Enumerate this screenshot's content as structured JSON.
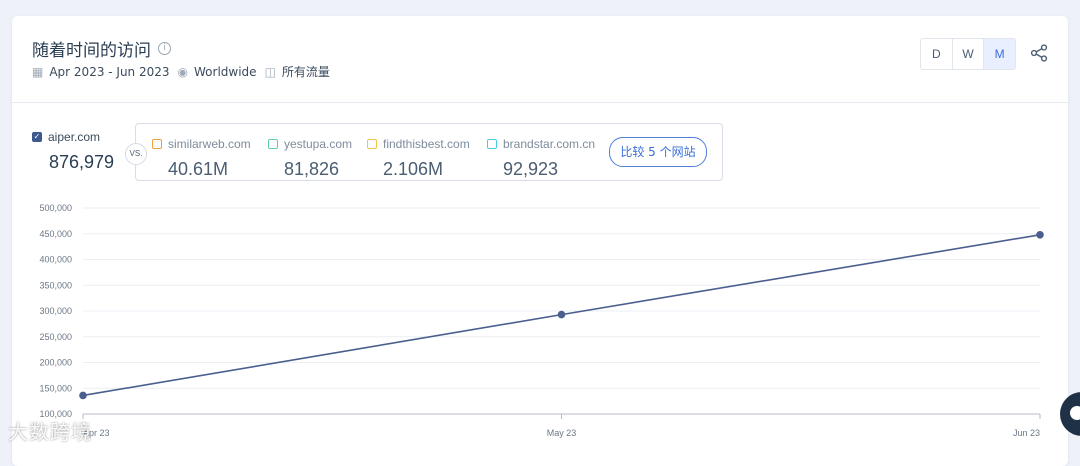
{
  "header": {
    "title": "随着时间的访问",
    "date_range": "Apr 2023 - Jun 2023",
    "region": "Worldwide",
    "traffic_type": "所有流量",
    "granularity": [
      "D",
      "W",
      "M"
    ],
    "selected_granularity": "M"
  },
  "main_site": {
    "name": "aiper.com",
    "value": "876,979",
    "checked": true
  },
  "vs_label": "VS.",
  "competitors": [
    {
      "name": "similarweb.com",
      "value": "40.61M",
      "color": "#f39a45"
    },
    {
      "name": "yestupa.com",
      "value": "81,826",
      "color": "#5ed1ac"
    },
    {
      "name": "findthisbest.com",
      "value": "2.106M",
      "color": "#f6c14e"
    },
    {
      "name": "brandstar.com.cn",
      "value": "92,923",
      "color": "#4dc7e6"
    }
  ],
  "compare_button": "比较 5 个网站",
  "chart_data": {
    "type": "line",
    "x": [
      "Apr 23",
      "May 23",
      "Jun 23"
    ],
    "series": [
      {
        "name": "aiper.com",
        "color": "#4a5f8e",
        "values": [
          136000,
          293000,
          448000
        ]
      }
    ],
    "ylim": [
      100000,
      500000
    ],
    "yticks": [
      "100,000",
      "150,000",
      "200,000",
      "250,000",
      "300,000",
      "350,000",
      "400,000",
      "450,000",
      "500,000"
    ],
    "grid": true
  },
  "watermark": "大数跨境"
}
